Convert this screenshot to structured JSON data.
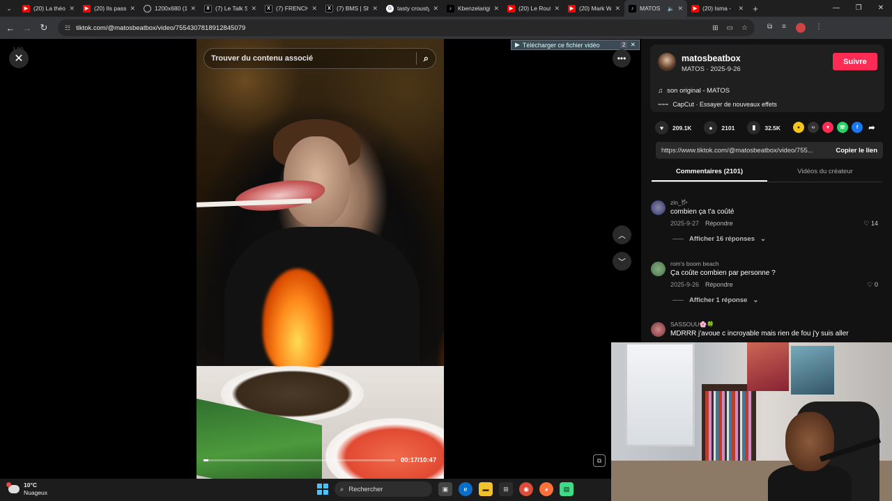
{
  "browser": {
    "tabs": [
      {
        "title": "(20) La théo",
        "icon": "youtube-icon"
      },
      {
        "title": "(20) Ils passe",
        "icon": "youtube-icon"
      },
      {
        "title": "1200x680 (1",
        "icon": "globe-icon"
      },
      {
        "title": "(7) Le Talk S",
        "icon": "x-icon"
      },
      {
        "title": "(7) FRENCH",
        "icon": "x-icon"
      },
      {
        "title": "(7) BMS | Sh",
        "icon": "x-icon"
      },
      {
        "title": "tasty crousty",
        "icon": "google-icon"
      },
      {
        "title": "Kbenzelarigi",
        "icon": "tiktok-icon"
      },
      {
        "title": "(20) Le Rout",
        "icon": "youtube-icon"
      },
      {
        "title": "(20) Mark W",
        "icon": "youtube-icon"
      },
      {
        "title": "MATOS",
        "icon": "tiktok-icon",
        "active": true
      },
      {
        "title": "(20) Isma - ",
        "icon": "youtube-icon"
      }
    ],
    "url": "tiktok.com/@matosbeatbox/video/7554307818912845079"
  },
  "player": {
    "speed": "1.00",
    "search_placeholder": "Trouver du contenu associé",
    "download_bar": "Télécharger ce fichier vidéo",
    "download_num": "2",
    "time": "00:17/10:47",
    "progress": 0.026
  },
  "creator": {
    "name": "matosbeatbox",
    "sub": "MATOS · 2025-9-26",
    "follow": "Suivre",
    "music": "son original - MATOS",
    "capcut": "CapCut · Essayer de nouveaux effets"
  },
  "stats": {
    "likes": "209.1K",
    "comments": "2101",
    "saves": "32.5K"
  },
  "share": {
    "url": "https://www.tiktok.com/@matosbeatbox/video/755...",
    "copy": "Copier le lien"
  },
  "side_tabs": {
    "comments": "Commentaires (2101)",
    "videos": "Vidéos du créateur"
  },
  "comments": [
    {
      "user": "zin_𐂂",
      "text": "combien ça t'a coûté",
      "date": "2025-9-27",
      "reply": "Répondre",
      "likes": "14",
      "more": "Afficher 16 réponses"
    },
    {
      "user": "rom's boom beach",
      "text": "Ça coûte combien par personne ?",
      "date": "2025-9-26",
      "reply": "Répondre",
      "likes": "0",
      "more": "Afficher 1 réponse"
    },
    {
      "user": "SASSOUU🌸🍀",
      "text": "MDRRR j'avoue c incroyable mais rien de fou j'y suis aller"
    }
  ],
  "taskbar": {
    "temp": "10°C",
    "weather": "Nuageux",
    "search": "Rechercher"
  },
  "colors": {
    "accent": "#fe2c55",
    "panel": "#121212"
  }
}
